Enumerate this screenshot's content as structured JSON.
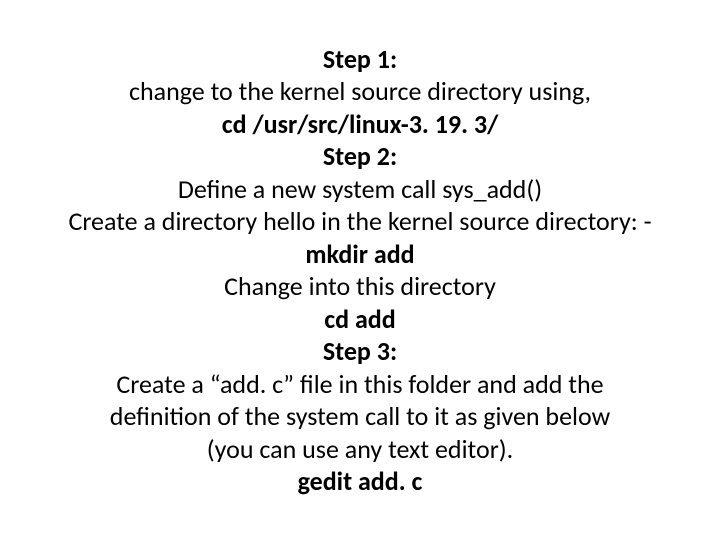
{
  "lines": [
    {
      "text": "Step 1:",
      "bold": true
    },
    {
      "text": "change to the kernel source directory using,",
      "bold": false
    },
    {
      "text": "cd /usr/src/linux-3. 19. 3/",
      "bold": true
    },
    {
      "text": "Step 2:",
      "bold": true
    },
    {
      "text": "Define a new system call sys_add()",
      "bold": false
    },
    {
      "text": "Create a directory hello in the kernel source directory: -",
      "bold": false
    },
    {
      "text": "mkdir add",
      "bold": true
    },
    {
      "text": "Change into this directory",
      "bold": false
    },
    {
      "text": "cd add",
      "bold": true
    },
    {
      "text": "Step 3:",
      "bold": true
    },
    {
      "text": "Create a “add. c” file in this folder and add the",
      "bold": false
    },
    {
      "text": "definition of the system call to it as given below",
      "bold": false
    },
    {
      "text": "(you can use any text editor).",
      "bold": false
    },
    {
      "text": "gedit add. c",
      "bold": true
    }
  ]
}
